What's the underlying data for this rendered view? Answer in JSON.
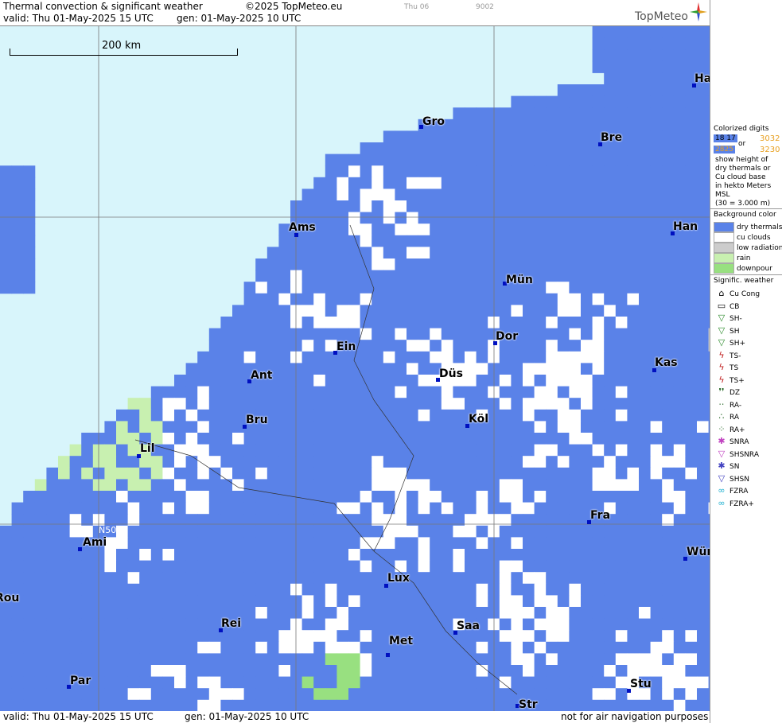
{
  "header": {
    "title": "Thermal convection & significant weather",
    "copyright": "©2025 TopMeteo.eu",
    "valid": "valid:  Thu  01-May-2025  15 UTC",
    "gen": "gen: 01-May-2025 10 UTC",
    "day_tag": "Thu 06",
    "code_tag": "9002",
    "logo": "TopMeteo"
  },
  "footer": {
    "valid": "valid:  Thu  01-May-2025  15 UTC",
    "gen": "gen: 01-May-2025 10 UTC",
    "note": "not for air navigation purposes"
  },
  "map": {
    "scale_label": "200 km",
    "grid_label": "N50",
    "cities": [
      "Gro",
      "Bre",
      "Ham",
      "Han",
      "Ams",
      "Mün",
      "Dor",
      "Ein",
      "Ant",
      "Düs",
      "Kas",
      "Köl",
      "Bru",
      "Lil",
      "Ami",
      "Fra",
      "Lux",
      "Wür",
      "Rei",
      "Saa",
      "Met",
      "Par",
      "Stu",
      "Str",
      "Rou"
    ],
    "colors": {
      "sea": "#d8f5fb",
      "dry_thermals": "#5a82e8",
      "cu_clouds": "#ffffff",
      "low_radiation": "#cccccc",
      "rain": "#c8f0b0",
      "downpour": "#98e080"
    }
  },
  "legend": {
    "title1": "Colorized digits",
    "sample_a": "18 17",
    "sample_b": "3032",
    "or": "or",
    "sample_c": "2825",
    "sample_d": "3230",
    "desc": [
      "show height of",
      "dry thermals or",
      "Cu cloud base",
      "in hekto Meters",
      "MSL",
      "(30 = 3.000 m)"
    ],
    "bg_title": "Background color",
    "bg_items": [
      "dry thermals",
      "cu clouds",
      "low radiation",
      "rain",
      "downpour"
    ],
    "sig_title": "Signific. weather",
    "sig_items": [
      "Cu Cong",
      "CB",
      "SH-",
      "SH",
      "SH+",
      "TS-",
      "TS",
      "TS+",
      "DZ",
      "RA-",
      "RA",
      "RA+",
      "SNRA",
      "SHSNRA",
      "SN",
      "SHSN",
      "FZRA",
      "FZRA+"
    ],
    "sig_icons": [
      "cu-cong",
      "cb",
      "sh-light",
      "sh",
      "sh-heavy",
      "ts-light",
      "ts",
      "ts-heavy",
      "dz",
      "ra-light",
      "ra",
      "ra-heavy",
      "snra",
      "shsnra",
      "sn",
      "shsn",
      "fzra",
      "fzra-heavy"
    ]
  }
}
